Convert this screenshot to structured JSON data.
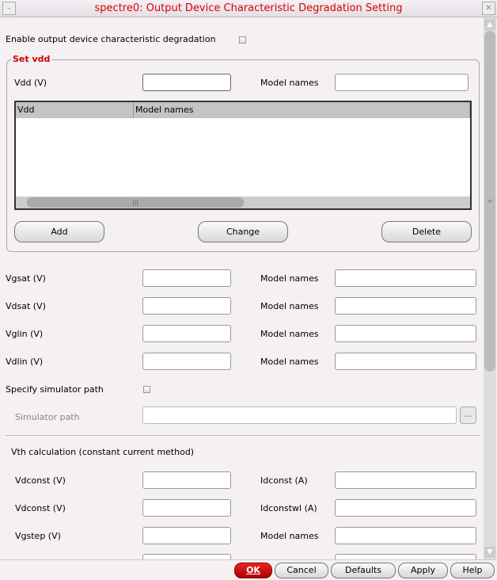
{
  "window": {
    "title": "spectre0: Output Device Characteristic Degradation Setting",
    "minimize_icon": "minimize-icon",
    "close_icon": "close-icon"
  },
  "enable_label": "Enable output device characteristic degradation",
  "set_vdd": {
    "title": "Set vdd",
    "vdd_label": "Vdd (V)",
    "model_label": "Model names",
    "table_headers": [
      "Vdd",
      "Model names"
    ],
    "add": "Add",
    "change": "Change",
    "delete": "Delete"
  },
  "rows": [
    {
      "label": "Vgsat (V)",
      "right": "Model names"
    },
    {
      "label": "Vdsat (V)",
      "right": "Model names"
    },
    {
      "label": "Vglin (V)",
      "right": "Model names"
    },
    {
      "label": "Vdlin (V)",
      "right": "Model names"
    }
  ],
  "sim": {
    "specify_label": "Specify simulator path",
    "path_label": "Simulator path",
    "browse": "..."
  },
  "vth": {
    "title": "Vth calculation (constant current method)",
    "rows": [
      {
        "label": "Vdconst (V)",
        "right": "Idconst (A)"
      },
      {
        "label": "Vdconst (V)",
        "right": "Idconstwl (A)"
      },
      {
        "label": "Vgstep (V)",
        "right": "Model names"
      }
    ]
  },
  "buttons": {
    "ok": "OK",
    "cancel": "Cancel",
    "defaults": "Defaults",
    "apply": "Apply",
    "help": "Help"
  }
}
